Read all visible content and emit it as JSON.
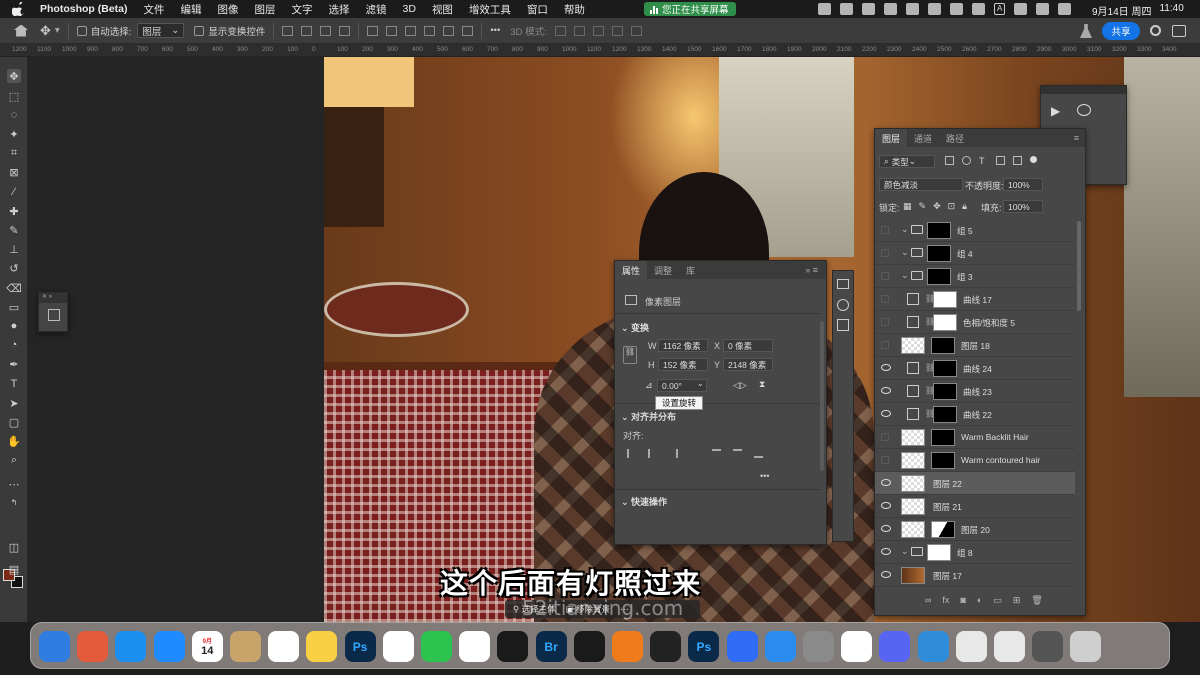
{
  "menubar": {
    "app_name": "Photoshop (Beta)",
    "items": [
      "文件",
      "编辑",
      "图像",
      "图层",
      "文字",
      "选择",
      "滤镜",
      "3D",
      "视图",
      "增效工具",
      "窗口",
      "帮助"
    ],
    "sharing_label": "您正在共享屏幕",
    "input_indicator": "A",
    "date": "9月14日 周四",
    "time": "11:40"
  },
  "options_bar": {
    "auto_select_label": "自动选择:",
    "auto_select_value": "图层",
    "show_transform_label": "显示变换控件",
    "mode_3d_label": "3D 模式:",
    "share_button": "共享"
  },
  "ruler": {
    "ticks": [
      "1200",
      "1100",
      "1000",
      "900",
      "800",
      "700",
      "600",
      "500",
      "400",
      "300",
      "200",
      "100",
      "0",
      "100",
      "200",
      "300",
      "400",
      "500",
      "600",
      "700",
      "800",
      "900",
      "1000",
      "1100",
      "1200",
      "1300",
      "1400",
      "1500",
      "1600",
      "1700",
      "1800",
      "1900",
      "2000",
      "2100",
      "2200",
      "2300",
      "2400",
      "2500",
      "2600",
      "2700",
      "2800",
      "2900",
      "3000",
      "3100",
      "3200",
      "3300",
      "3400"
    ]
  },
  "colors": {
    "foreground": "#7a2a17",
    "background": "#111111",
    "accent": "#1473e6",
    "share_green": "#2f8f4a"
  },
  "properties": {
    "tabs": [
      "属性",
      "调整",
      "库"
    ],
    "layer_type": "像素图层",
    "transform_title": "变换",
    "w_label": "W",
    "w_value": "1162 像素",
    "h_label": "H",
    "h_value": "152 像素",
    "x_label": "X",
    "x_value": "0 像素",
    "y_label": "Y",
    "y_value": "2148 像素",
    "rotation_value": "0.00°",
    "tooltip": "设置旋转",
    "align_title": "对齐并分布",
    "align_label": "对齐:",
    "quick_actions_title": "快速操作",
    "more": "•••"
  },
  "layers_panel": {
    "tabs": [
      "图层",
      "通道",
      "路径"
    ],
    "filter_label": "类型",
    "blend_mode": "颜色减淡",
    "opacity_label": "不透明度:",
    "opacity_value": "100%",
    "lock_label": "锁定:",
    "fill_label": "填充:",
    "fill_value": "100%",
    "layers": [
      {
        "name": "组 5",
        "visible": false,
        "kind": "group"
      },
      {
        "name": "组 4",
        "visible": false,
        "kind": "group"
      },
      {
        "name": "组 3",
        "visible": false,
        "kind": "group"
      },
      {
        "name": "曲线 17",
        "visible": false,
        "kind": "adjust"
      },
      {
        "name": "色相/饱和度 5",
        "visible": false,
        "kind": "adjust"
      },
      {
        "name": "图层 18",
        "visible": false,
        "kind": "pixel"
      },
      {
        "name": "曲线 24",
        "visible": true,
        "kind": "adjust"
      },
      {
        "name": "曲线 23",
        "visible": true,
        "kind": "adjust"
      },
      {
        "name": "曲线 22",
        "visible": true,
        "kind": "adjust"
      },
      {
        "name": "Warm Backlit Hair",
        "visible": false,
        "kind": "smart"
      },
      {
        "name": "Warm contoured hair",
        "visible": false,
        "kind": "smart"
      },
      {
        "name": "图层 22",
        "visible": true,
        "kind": "pixel",
        "selected": true
      },
      {
        "name": "图层 21",
        "visible": true,
        "kind": "pixel"
      },
      {
        "name": "图层 20",
        "visible": true,
        "kind": "pixel"
      },
      {
        "name": "组 8",
        "visible": true,
        "kind": "group"
      },
      {
        "name": "图层 17",
        "visible": true,
        "kind": "photo"
      }
    ]
  },
  "context_bar": {
    "select_subject": "选择主体",
    "remove_bg": "移除背景"
  },
  "subtitle": "这个后面有灯照过来",
  "watermark": "52itianxing.com",
  "dock": {
    "calendar_month": "9月",
    "calendar_day": "14",
    "apps": [
      "finder-icon",
      "launchpad-icon",
      "safari-icon",
      "appstore-icon",
      "calendar-icon",
      "contacts-icon",
      "reminders-icon",
      "notes-icon",
      "photoshop-icon",
      "freeform-icon",
      "wechat-icon",
      "pinwheel-icon",
      "finalcut-icon",
      "bridge-icon",
      "onepassword-icon",
      "gopro-icon",
      "obs-icon",
      "photoshop-beta-icon",
      "mountain-icon",
      "keynote-icon",
      "settings-icon",
      "chrome-icon",
      "discord-icon",
      "accessibility-icon",
      "window-thumb-icon",
      "window-thumb-icon",
      "window-thumb-icon",
      "trash-icon"
    ],
    "ps_label": "Ps",
    "br_label": "Br"
  }
}
